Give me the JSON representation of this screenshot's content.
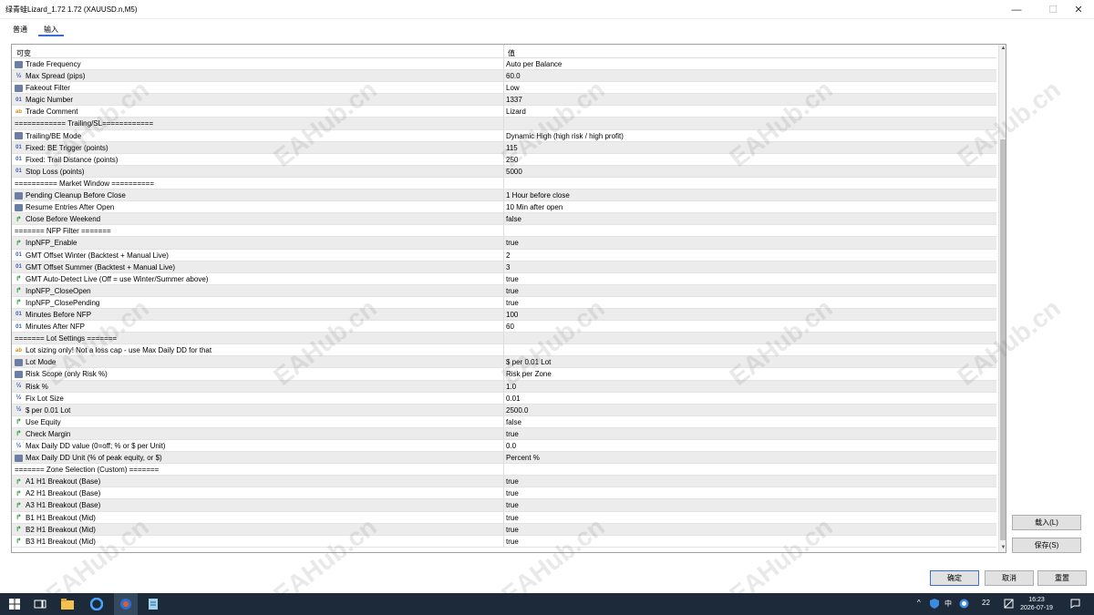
{
  "window": {
    "title": "绿青蛙Lizard_1.72 1.72 (XAUUSD.n,M5)",
    "minimize_glyph": "—",
    "maximize_glyph": "☐",
    "close_glyph": "✕"
  },
  "tabs": [
    {
      "label": "普通"
    },
    {
      "label": "输入"
    }
  ],
  "table": {
    "headers": {
      "variable": "可变",
      "value": "值"
    },
    "rows": [
      {
        "type": "enum",
        "name": "Trade Frequency",
        "value": "Auto per Balance"
      },
      {
        "type": "double",
        "name": "Max Spread (pips)",
        "value": "60.0"
      },
      {
        "type": "enum",
        "name": "Fakeout Filter",
        "value": "Low"
      },
      {
        "type": "int",
        "name": "Magic Number",
        "value": "1337"
      },
      {
        "type": "string",
        "name": "Trade Comment",
        "value": "Lizard"
      },
      {
        "type": "none",
        "name": "============ Trailing/SL============",
        "value": ""
      },
      {
        "type": "enum",
        "name": "Trailing/BE Mode",
        "value": "Dynamic High (high risk / high profit)"
      },
      {
        "type": "int",
        "name": "Fixed: BE Trigger (points)",
        "value": "115"
      },
      {
        "type": "int",
        "name": "Fixed: Trail Distance (points)",
        "value": "250"
      },
      {
        "type": "int",
        "name": "Stop Loss (points)",
        "value": "5000"
      },
      {
        "type": "none",
        "name": "========== Market Window ==========",
        "value": ""
      },
      {
        "type": "enum",
        "name": "Pending Cleanup Before Close",
        "value": "1 Hour before close"
      },
      {
        "type": "enum",
        "name": "Resume Entries After Open",
        "value": "10 Min after open"
      },
      {
        "type": "bool",
        "name": "Close Before Weekend",
        "value": "false"
      },
      {
        "type": "none",
        "name": "======= NFP Filter =======",
        "value": ""
      },
      {
        "type": "bool",
        "name": "InpNFP_Enable",
        "value": "true"
      },
      {
        "type": "int",
        "name": "GMT Offset Winter (Backtest + Manual Live)",
        "value": "2"
      },
      {
        "type": "int",
        "name": "GMT Offset Summer (Backtest + Manual Live)",
        "value": "3"
      },
      {
        "type": "bool",
        "name": "GMT Auto-Detect Live (Off = use Winter/Summer above)",
        "value": "true"
      },
      {
        "type": "bool",
        "name": "InpNFP_CloseOpen",
        "value": "true"
      },
      {
        "type": "bool",
        "name": "InpNFP_ClosePending",
        "value": "true"
      },
      {
        "type": "int",
        "name": "Minutes Before NFP",
        "value": "100"
      },
      {
        "type": "int",
        "name": "Minutes After NFP",
        "value": "60"
      },
      {
        "type": "none",
        "name": "======= Lot Settings =======",
        "value": ""
      },
      {
        "type": "string",
        "name": "Lot sizing only! Not a loss cap - use Max Daily DD for that",
        "value": ""
      },
      {
        "type": "enum",
        "name": "Lot Mode",
        "value": "$ per 0.01 Lot"
      },
      {
        "type": "enum",
        "name": "Risk Scope (only Risk %)",
        "value": "Risk per Zone"
      },
      {
        "type": "double",
        "name": "Risk %",
        "value": "1.0"
      },
      {
        "type": "double",
        "name": "Fix Lot Size",
        "value": "0.01"
      },
      {
        "type": "double",
        "name": "$ per 0.01 Lot",
        "value": "2500.0"
      },
      {
        "type": "bool",
        "name": "Use Equity",
        "value": "false"
      },
      {
        "type": "bool",
        "name": "Check Margin",
        "value": "true"
      },
      {
        "type": "double",
        "name": "Max Daily DD value (0=off; % or $ per Unit)",
        "value": "0.0"
      },
      {
        "type": "enum",
        "name": "Max Daily DD Unit (% of peak equity, or $)",
        "value": "Percent %"
      },
      {
        "type": "none",
        "name": "======= Zone Selection (Custom) =======",
        "value": ""
      },
      {
        "type": "bool",
        "name": "A1 H1 Breakout (Base)",
        "value": "true"
      },
      {
        "type": "bool",
        "name": "A2 H1 Breakout (Base)",
        "value": "true"
      },
      {
        "type": "bool",
        "name": "A3 H1 Breakout (Base)",
        "value": "true"
      },
      {
        "type": "bool",
        "name": "B1 H1 Breakout (Mid)",
        "value": "true"
      },
      {
        "type": "bool",
        "name": "B2 H1 Breakout (Mid)",
        "value": "true"
      },
      {
        "type": "bool",
        "name": "B3 H1 Breakout (Mid)",
        "value": "true"
      }
    ]
  },
  "icon_glyphs": {
    "enum": "",
    "double": "½",
    "int": "01",
    "string": "ab",
    "bool": "↱",
    "none": ""
  },
  "buttons": {
    "load": "载入(L)",
    "save": "保存(S)",
    "ok": "确定",
    "cancel": "取消",
    "reset": "重置"
  },
  "watermark": "EAHub.cn",
  "taskbar": {
    "ime": "中",
    "badge": "22",
    "time": "16:23",
    "date": "2026-07-19"
  }
}
